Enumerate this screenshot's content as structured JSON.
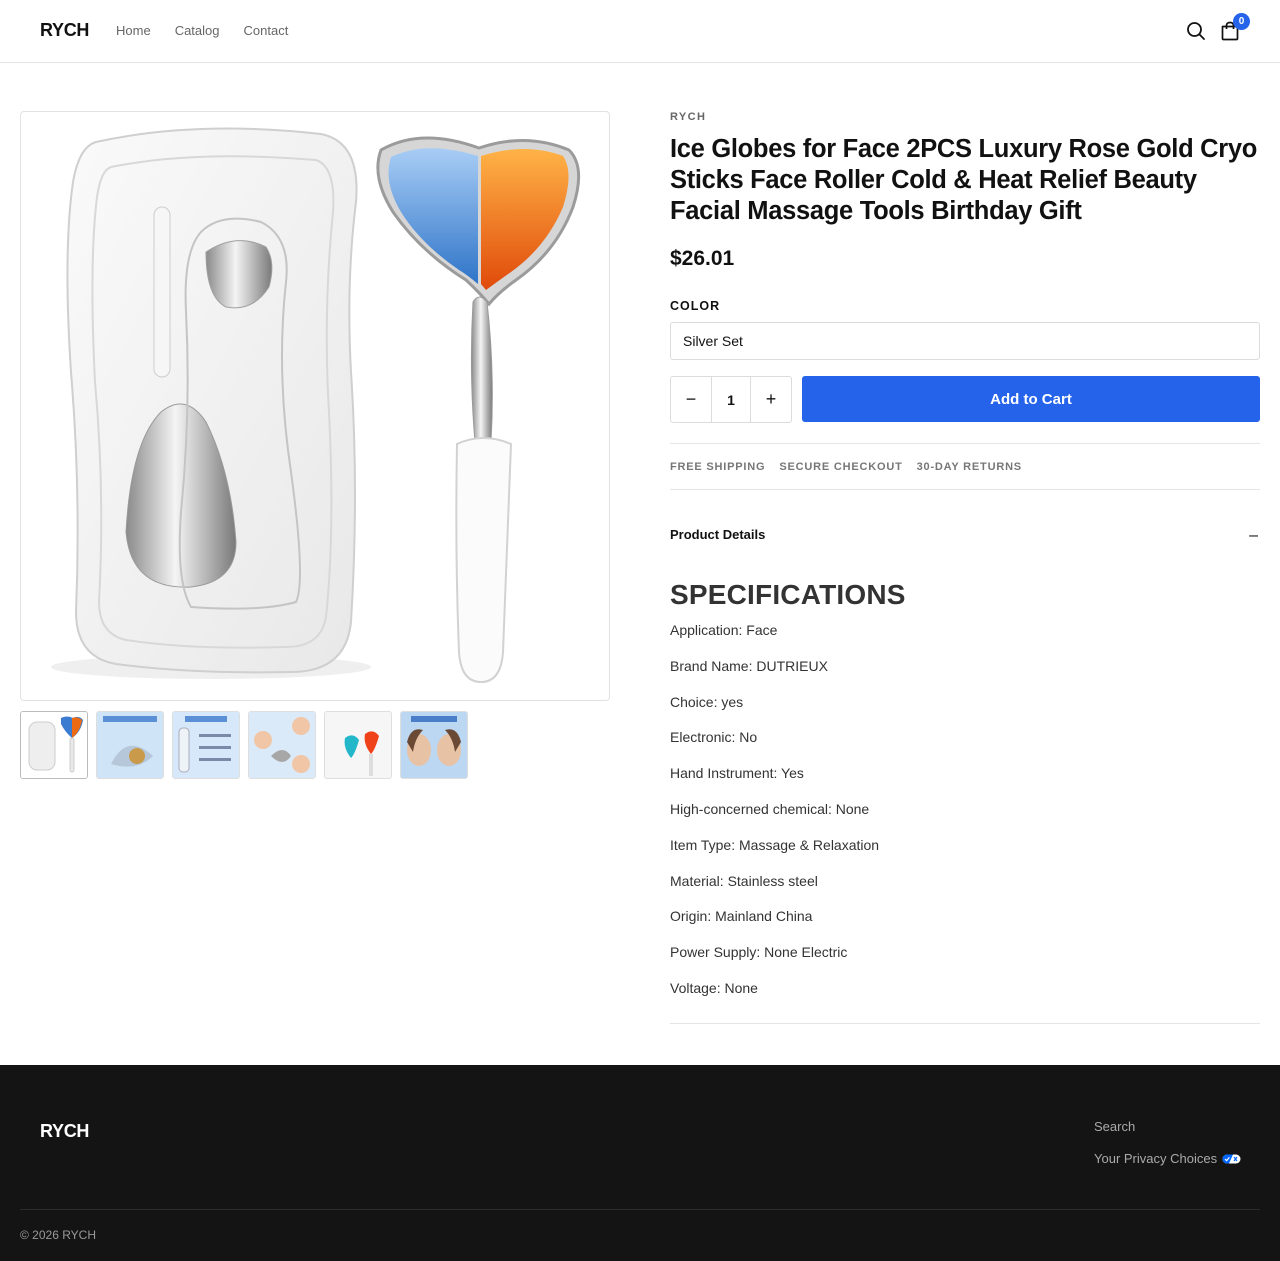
{
  "header": {
    "logo": "RYCH",
    "nav": [
      "Home",
      "Catalog",
      "Contact"
    ],
    "cart_count": "0"
  },
  "gallery": {
    "main_image": "Product image: clear storage case with silver face roller and heart-shaped ice globe (ice and fire halves)",
    "thumbnails": [
      {
        "name": "thumb-1"
      },
      {
        "name": "thumb-2"
      },
      {
        "name": "thumb-3"
      },
      {
        "name": "thumb-4"
      },
      {
        "name": "thumb-5"
      },
      {
        "name": "thumb-6"
      }
    ]
  },
  "product": {
    "vendor": "RYCH",
    "title": "Ice Globes for Face 2PCS Luxury Rose Gold Cryo Sticks Face Roller Cold & Heat Relief Beauty Facial Massage Tools Birthday Gift",
    "price": "$26.01",
    "option_label": "COLOR",
    "option_value": "Silver Set",
    "quantity": "1",
    "minus": "−",
    "plus": "+",
    "add_to_cart": "Add to Cart",
    "badges": [
      "FREE SHIPPING",
      "SECURE CHECKOUT",
      "30-DAY RETURNS"
    ],
    "details_label": "Product Details",
    "details_toggle": "–",
    "spec_heading": "SPECIFICATIONS",
    "specs": [
      "Application: Face",
      "Brand Name: DUTRIEUX",
      "Choice: yes",
      "Electronic: No",
      "Hand Instrument: Yes",
      "High-concerned chemical: None",
      "Item Type: Massage & Relaxation",
      "Material: Stainless steel",
      "Origin: Mainland China",
      "Power Supply: None Electric",
      "Voltage: None"
    ]
  },
  "footer": {
    "logo": "RYCH",
    "links": [
      "Search",
      "Your Privacy Choices"
    ],
    "copyright": "© 2026 RYCH"
  },
  "colors": {
    "accent": "#2563eb",
    "footer_bg": "#141414"
  }
}
